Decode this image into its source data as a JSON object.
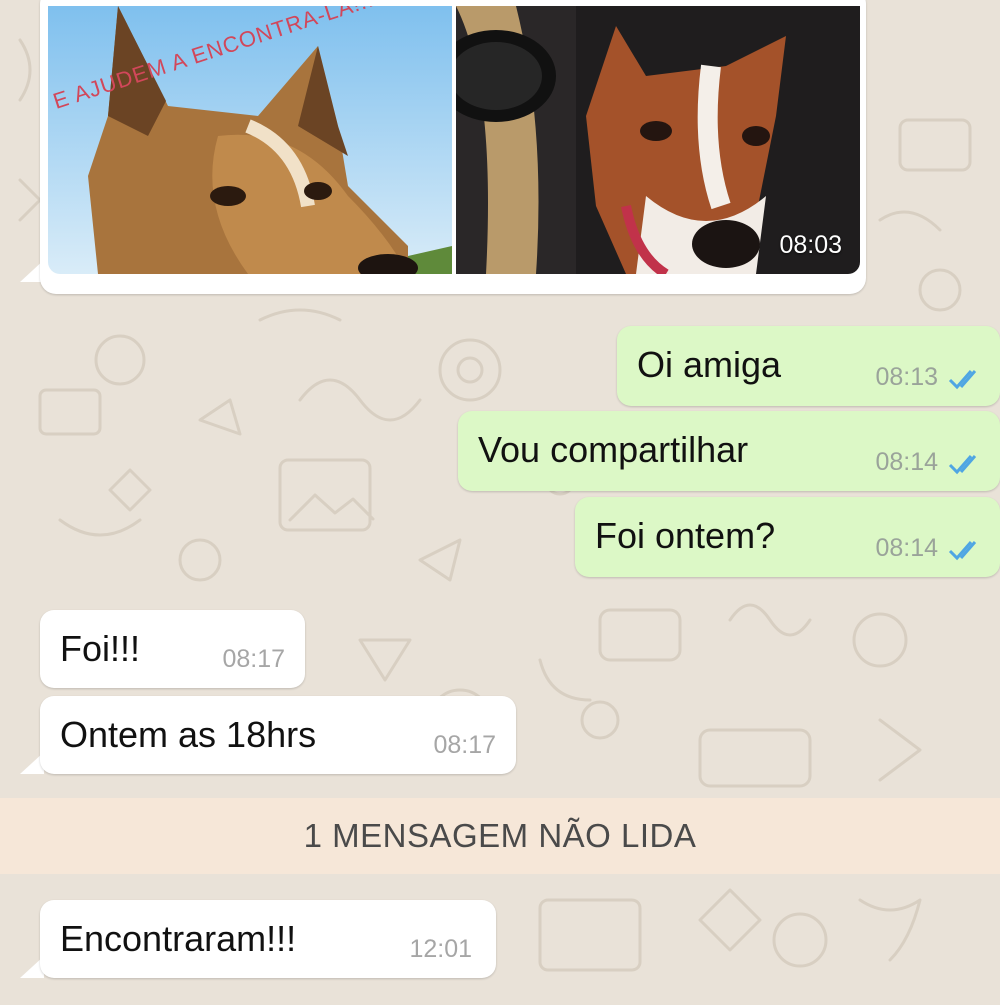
{
  "colors": {
    "background": "#e9e2d8",
    "outgoing_bubble": "#dcf8c6",
    "incoming_bubble": "#ffffff",
    "read_ticks": "#4fa6e3",
    "unread_banner": "#f6e7d8"
  },
  "image_message": {
    "overlay_text": "E AJUDEM A ENCONTRA-LA!!!",
    "time": "08:03"
  },
  "outgoing": [
    {
      "text": "Oi amiga",
      "time": "08:13",
      "status_icon": "double-check-read-icon"
    },
    {
      "text": "Vou compartilhar",
      "time": "08:14",
      "status_icon": "double-check-read-icon"
    },
    {
      "text": "Foi ontem?",
      "time": "08:14",
      "status_icon": "double-check-read-icon"
    }
  ],
  "incoming": [
    {
      "text": "Foi!!!",
      "time": "08:17"
    },
    {
      "text": "Ontem as 18hrs",
      "time": "08:17"
    }
  ],
  "unread_banner": "1 MENSAGEM NÃO LIDA",
  "incoming_after": [
    {
      "text": "Encontraram!!!",
      "time": "12:01"
    }
  ]
}
